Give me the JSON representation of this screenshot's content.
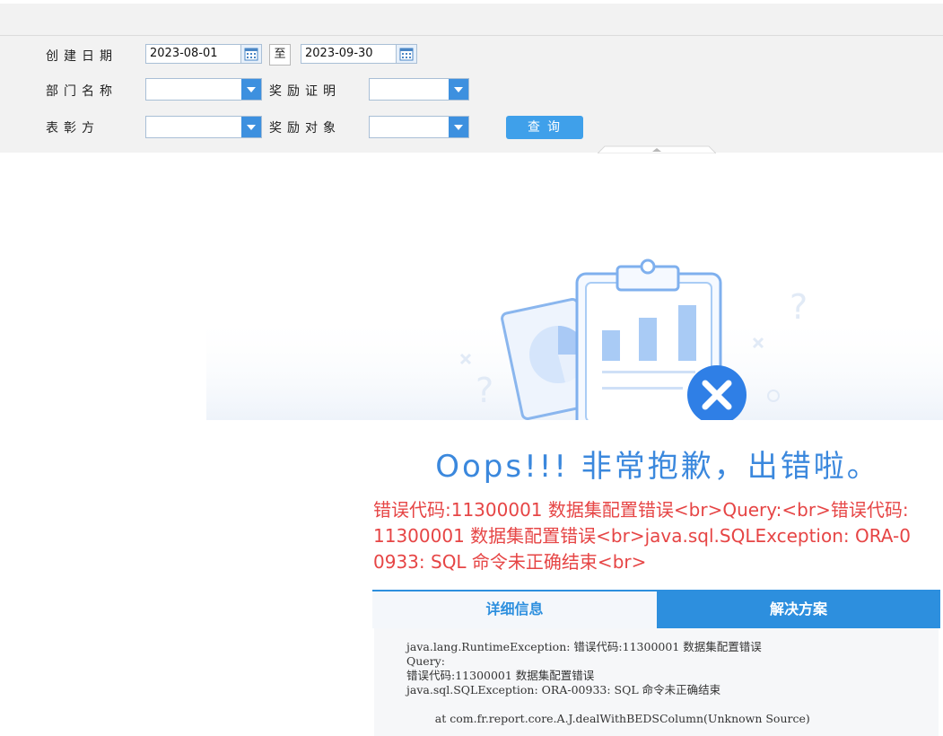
{
  "filters": {
    "create_date_label": "创建日期",
    "date_from": "2023-08-01",
    "to_label": "至",
    "date_to": "2023-09-30",
    "dept_label": "部门名称",
    "award_cert_label": "奖励证明",
    "commend_label": "表彰方",
    "award_target_label": "奖励对象",
    "query_button": "查询",
    "dept_value": "",
    "award_cert_value": "",
    "commend_value": "",
    "award_target_value": ""
  },
  "error": {
    "title": "Oops!!! 非常抱歉，出错啦。",
    "message": "错误代码:11300001 数据集配置错误<br>Query:<br>错误代码:11300001 数据集配置错误<br>java.sql.SQLException: ORA-00933: SQL 命令未正确结束<br>",
    "tabs": [
      "详细信息",
      "解决方案"
    ],
    "detail_lines": [
      "java.lang.RuntimeException: 错误代码:11300001 数据集配置错误",
      "Query:",
      "错误代码:11300001 数据集配置错误",
      "java.sql.SQLException: ORA-00933: SQL 命令未正确结束",
      "",
      "        at com.fr.report.core.A.J.dealWithBEDSColumn(Unknown Source)"
    ]
  },
  "colors": {
    "accent": "#2d8fde",
    "error_red": "#e64545",
    "oops_blue": "#3b88dd"
  }
}
